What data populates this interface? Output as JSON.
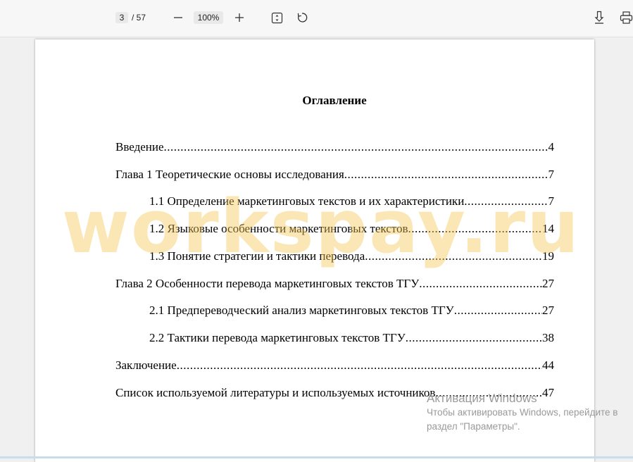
{
  "toolbar": {
    "current_page": "3",
    "page_total": "/ 57",
    "zoom": "100%",
    "icons": [
      "zoom-out-icon",
      "zoom-in-icon",
      "fit-page-icon",
      "rotate-icon",
      "download-icon",
      "print-icon"
    ]
  },
  "document": {
    "title": "Оглавление",
    "entries": [
      {
        "label": "Введение",
        "page": "4"
      },
      {
        "label": "Глава 1 Теоретические основы исследования",
        "page": "7"
      },
      {
        "label": "1.1 Определение маркетинговых текстов и их характеристики",
        "page": "7"
      },
      {
        "label": "1.2 Языковые особенности маркетинговых текстов",
        "page": "14"
      },
      {
        "label": "1.3 Понятие стратегии и тактики перевода",
        "page": "19"
      },
      {
        "label": "Глава 2 Особенности перевода маркетинговых текстов ТГУ",
        "page": "27"
      },
      {
        "label": "2.1 Предпереводческий анализ маркетинговых текстов ТГУ",
        "page": "27"
      },
      {
        "label": "2.2 Тактики перевода маркетинговых текстов ТГУ",
        "page": "38"
      },
      {
        "label": "Заключение",
        "page": "44"
      },
      {
        "label": "Список используемой литературы и используемых источников",
        "page": "47"
      }
    ],
    "watermark": "workspay.ru"
  },
  "system_overlay": {
    "line1": "Активация Windows",
    "line2": "Чтобы активировать Windows, перейдите в",
    "line3": "раздел \"Параметры\"."
  }
}
